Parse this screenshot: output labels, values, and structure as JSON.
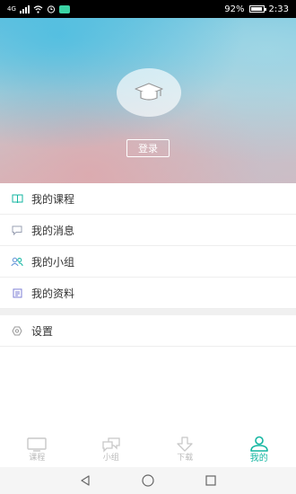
{
  "status": {
    "network": "4G",
    "battery": "92%",
    "time": "2:33"
  },
  "header": {
    "login_label": "登录"
  },
  "menu": {
    "items": [
      {
        "label": "我的课程",
        "icon": "book-icon"
      },
      {
        "label": "我的消息",
        "icon": "message-icon"
      },
      {
        "label": "我的小组",
        "icon": "group-icon"
      },
      {
        "label": "我的资料",
        "icon": "profile-icon"
      }
    ],
    "settings": {
      "label": "设置",
      "icon": "settings-icon"
    }
  },
  "tabs": [
    {
      "label": "课程",
      "icon": "monitor-icon",
      "active": false
    },
    {
      "label": "小组",
      "icon": "chat-icon",
      "active": false
    },
    {
      "label": "下载",
      "icon": "download-icon",
      "active": false
    },
    {
      "label": "我的",
      "icon": "person-icon",
      "active": true
    }
  ],
  "colors": {
    "accent": "#13b6a1",
    "inactive": "#bbbbbb"
  }
}
